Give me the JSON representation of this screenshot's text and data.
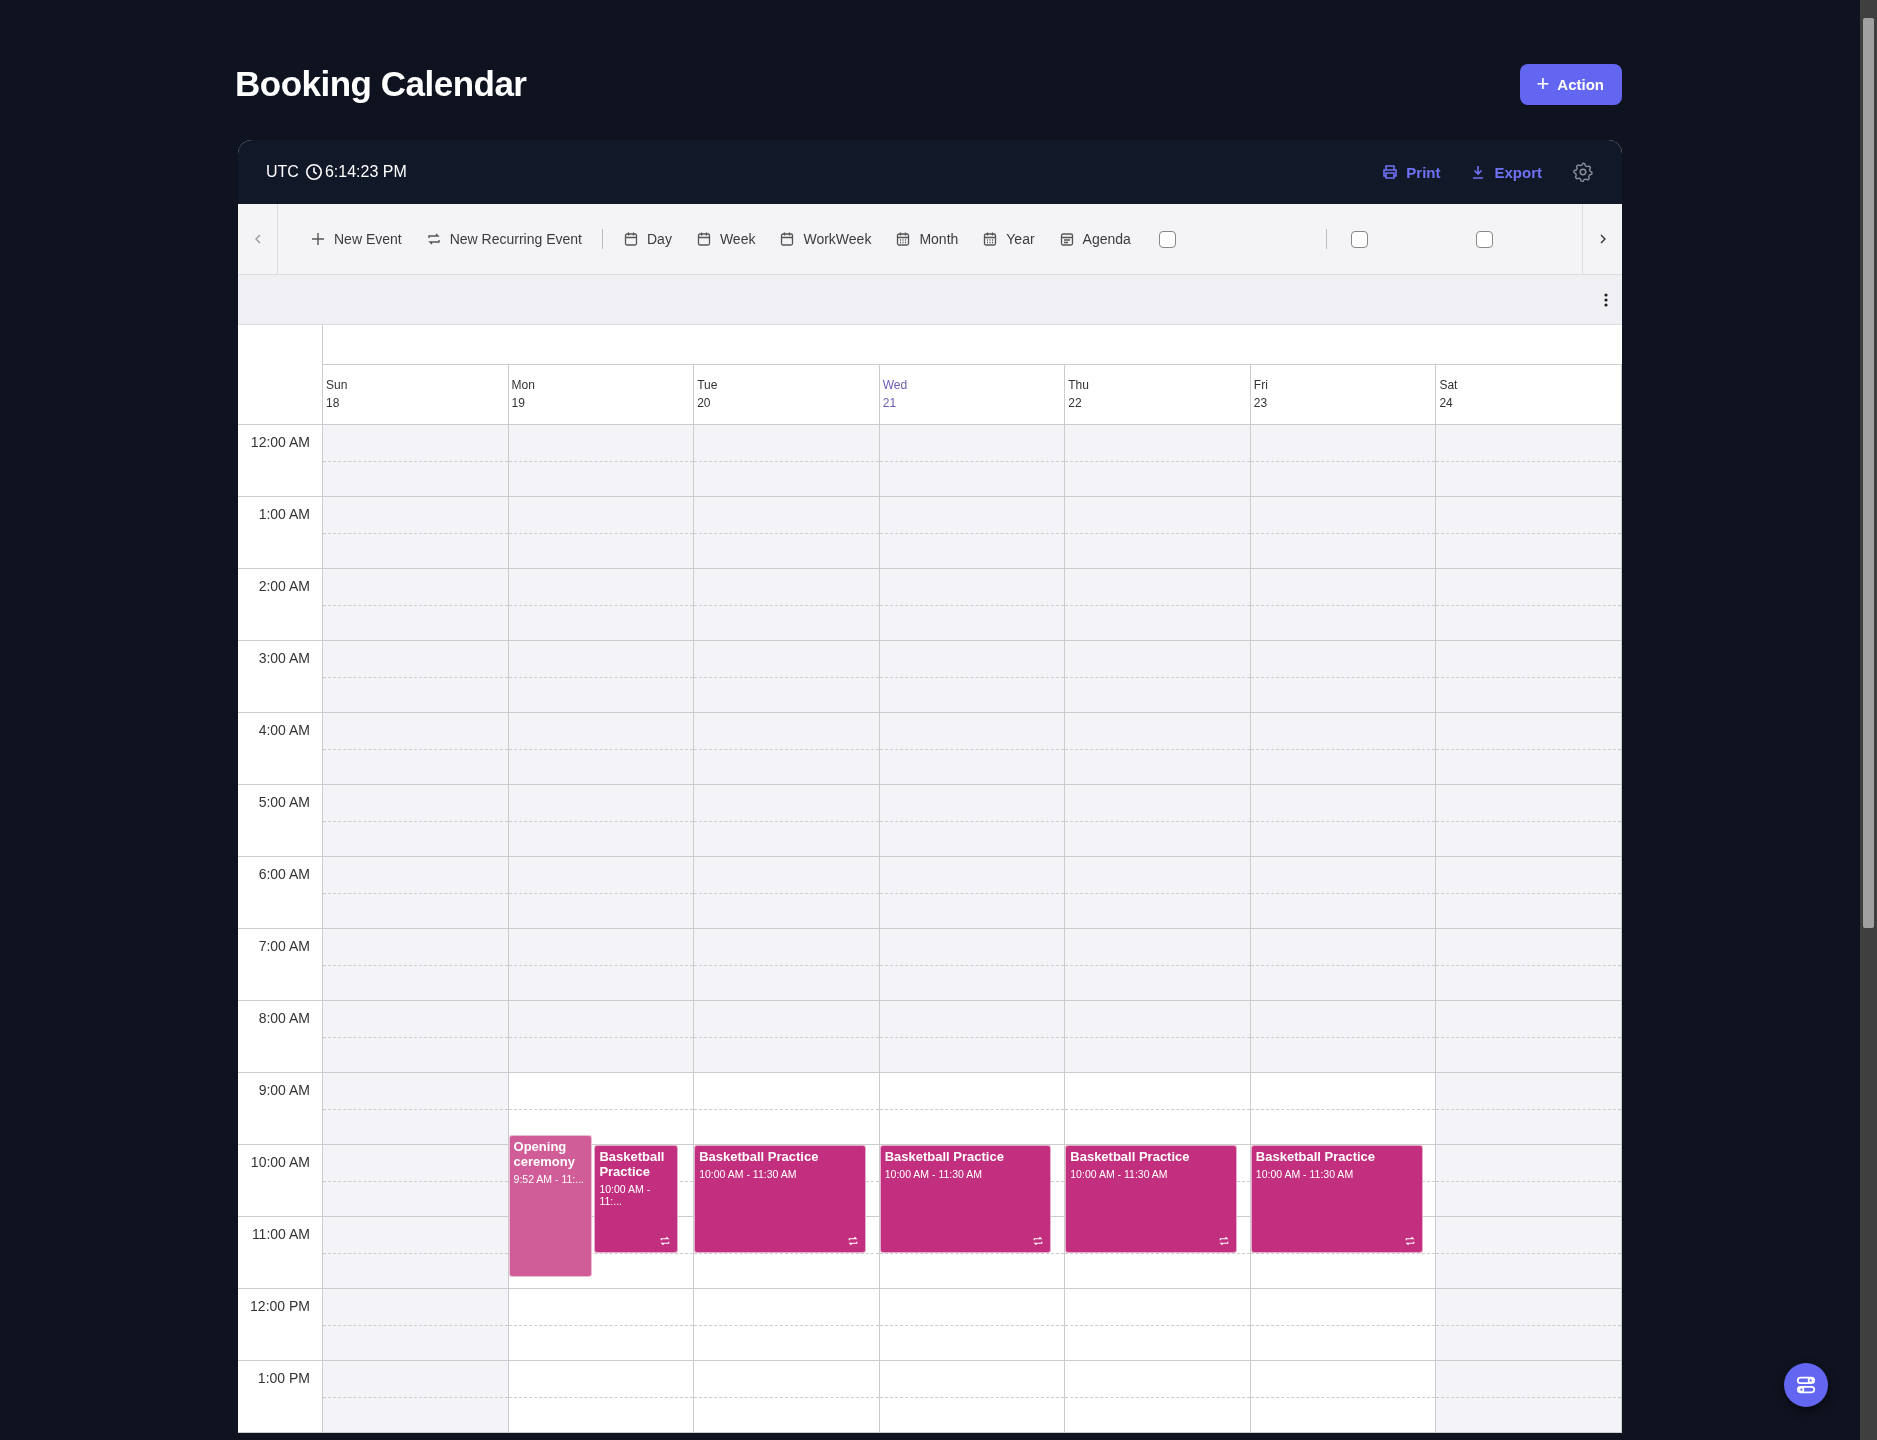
{
  "page": {
    "title": "Booking Calendar",
    "action_button": {
      "label": "Action",
      "icon": "+"
    }
  },
  "header": {
    "timezone": "UTC",
    "clock": "6:14:23 PM",
    "print": "Print",
    "export": "Export"
  },
  "toolbar": [
    {
      "kind": "add",
      "label": "New Event"
    },
    {
      "kind": "recurring",
      "label": "New Recurring Event"
    },
    {
      "kind": "separator"
    },
    {
      "kind": "view",
      "label": "Day"
    },
    {
      "kind": "view",
      "label": "Week"
    },
    {
      "kind": "view",
      "label": "WorkWeek"
    },
    {
      "kind": "gridview",
      "label": "Month"
    },
    {
      "kind": "gridview",
      "label": "Year"
    },
    {
      "kind": "agenda",
      "label": "Agenda"
    },
    {
      "kind": "checkbox",
      "checked": false
    },
    {
      "kind": "separator"
    },
    {
      "kind": "checkbox",
      "checked": false
    },
    {
      "kind": "checkbox",
      "checked": false
    }
  ],
  "days": [
    {
      "name": "Sun",
      "date": "18",
      "selected": false,
      "kind": "weekend"
    },
    {
      "name": "Mon",
      "date": "19",
      "selected": false,
      "kind": "weekday"
    },
    {
      "name": "Tue",
      "date": "20",
      "selected": false,
      "kind": "weekday"
    },
    {
      "name": "Wed",
      "date": "21",
      "selected": true,
      "kind": "weekday"
    },
    {
      "name": "Thu",
      "date": "22",
      "selected": false,
      "kind": "weekday"
    },
    {
      "name": "Fri",
      "date": "23",
      "selected": false,
      "kind": "weekday"
    },
    {
      "name": "Sat",
      "date": "24",
      "selected": false,
      "kind": "weekend"
    }
  ],
  "hours": [
    {
      "label": "12:00 AM",
      "kind": "off"
    },
    {
      "label": "1:00 AM",
      "kind": "off"
    },
    {
      "label": "2:00 AM",
      "kind": "off"
    },
    {
      "label": "3:00 AM",
      "kind": "off"
    },
    {
      "label": "4:00 AM",
      "kind": "off"
    },
    {
      "label": "5:00 AM",
      "kind": "off"
    },
    {
      "label": "6:00 AM",
      "kind": "off"
    },
    {
      "label": "7:00 AM",
      "kind": "off"
    },
    {
      "label": "8:00 AM",
      "kind": "off"
    },
    {
      "label": "9:00 AM",
      "kind": "work"
    },
    {
      "label": "10:00 AM",
      "kind": "work"
    },
    {
      "label": "11:00 AM",
      "kind": "work"
    },
    {
      "label": "12:00 PM",
      "kind": "work"
    },
    {
      "label": "1:00 PM",
      "kind": "work"
    }
  ],
  "events": [
    {
      "title": "Opening ceremony",
      "time": "9:52 AM - 11:...",
      "recurring": false,
      "color": "#d05d98"
    },
    {
      "title": "Basketball Practice",
      "time": "10:00 AM - 11:...",
      "recurring": true,
      "color": "#c22f7e"
    },
    {
      "title": "Basketball Practice",
      "time": "10:00 AM - 11:30 AM",
      "recurring": true,
      "color": "#c22f7e"
    },
    {
      "title": "Basketball Practice",
      "time": "10:00 AM - 11:30 AM",
      "recurring": true,
      "color": "#c22f7e"
    },
    {
      "title": "Basketball Practice",
      "time": "10:00 AM - 11:30 AM",
      "recurring": true,
      "color": "#c22f7e"
    },
    {
      "title": "Basketball Practice",
      "time": "10:00 AM - 11:30 AM",
      "recurring": true,
      "color": "#c22f7e"
    }
  ]
}
